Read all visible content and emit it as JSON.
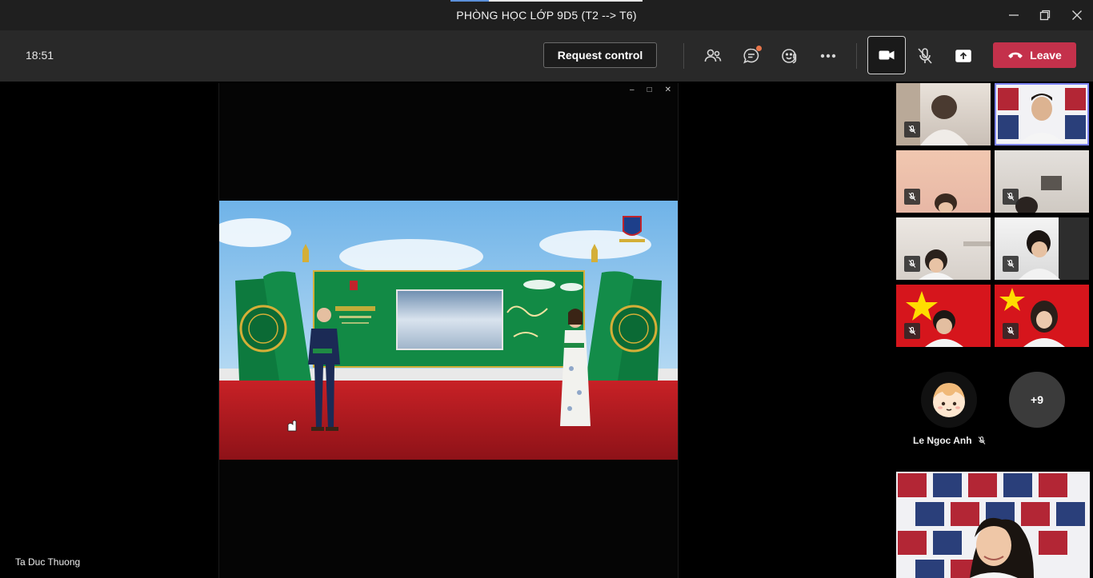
{
  "window": {
    "title": "PHÒNG HỌC LỚP 9D5 (T2 --> T6)"
  },
  "toolbar": {
    "clock": "18:51",
    "request_control_label": "Request control",
    "leave_label": "Leave"
  },
  "stage": {
    "presenter_name": "Ta Duc Thuong"
  },
  "participants": {
    "avatar_name": "Le Ngoc Anh",
    "more_count": "+9"
  },
  "colors": {
    "leave_red": "#c4314b",
    "active_tile_outline": "#7f85f5",
    "toolbar_bg": "#292929",
    "titlebar_bg": "#1f1f1f"
  }
}
